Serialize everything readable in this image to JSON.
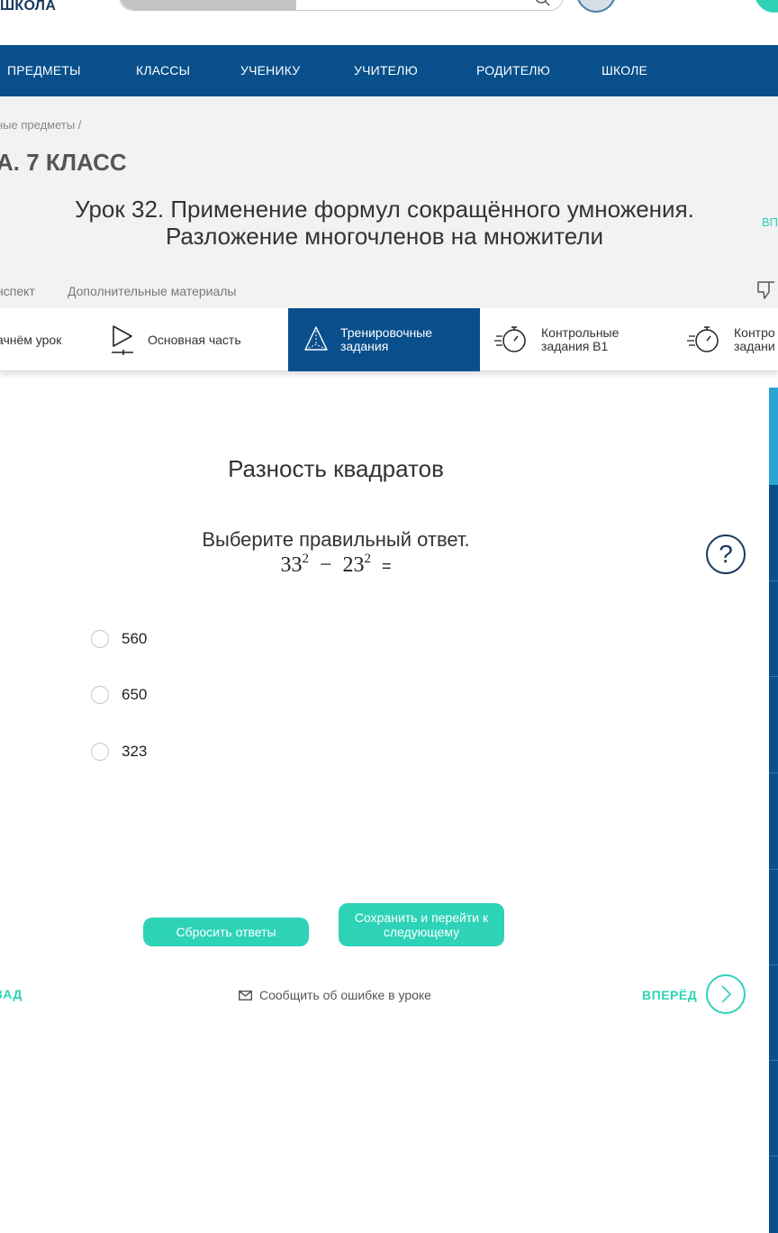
{
  "header": {
    "logo_text": "ШКОЛА"
  },
  "nav": {
    "items": [
      "ПРЕДМЕТЫ",
      "КЛАССЫ",
      "УЧЕНИКУ",
      "УЧИТЕЛЮ",
      "РОДИТЕЛЮ",
      "ШКОЛЕ"
    ]
  },
  "page": {
    "breadcrumb": "ные предметы  /",
    "class_title": "А. 7 КЛАСС",
    "lesson_title_line1": "Урок 32. Применение формул сокращённого умножения.",
    "lesson_title_line2": "Разложение многочленов на множители",
    "side_link": "ВП",
    "sub_tabs": [
      "нспект",
      "Дополнительные материалы"
    ]
  },
  "section_tabs": [
    {
      "label_line1": "ачнём урок",
      "label_line2": "",
      "icon": "start-icon",
      "active": false
    },
    {
      "label_line1": "Основная часть",
      "label_line2": "",
      "icon": "play-icon",
      "active": false
    },
    {
      "label_line1": "Тренировочные",
      "label_line2": "задания",
      "icon": "pyramid-icon",
      "active": true
    },
    {
      "label_line1": "Контрольные",
      "label_line2": "задания В1",
      "icon": "stopwatch-icon",
      "active": false
    },
    {
      "label_line1": "Контро",
      "label_line2": "задани",
      "icon": "stopwatch-icon",
      "active": false
    }
  ],
  "task": {
    "title": "Разность квадратов",
    "instruction": "Выберите правильный ответ.",
    "formula": {
      "base1": "33",
      "exp1": "2",
      "op": "−",
      "base2": "23",
      "exp2": "2",
      "eq": "="
    },
    "help_label": "?",
    "options": [
      "560",
      "650",
      "323"
    ]
  },
  "buttons": {
    "reset": "Сбросить ответы",
    "save": "Сохранить и перейти к следующему"
  },
  "footer": {
    "back": "ЗАД",
    "report": "Сообщить об ошибке в уроке",
    "forward": "ВПЕРЁД"
  },
  "colors": {
    "nav_blue": "#084f8c",
    "accent_teal": "#2ed3b7",
    "gray_bg": "#f2f2f2"
  }
}
